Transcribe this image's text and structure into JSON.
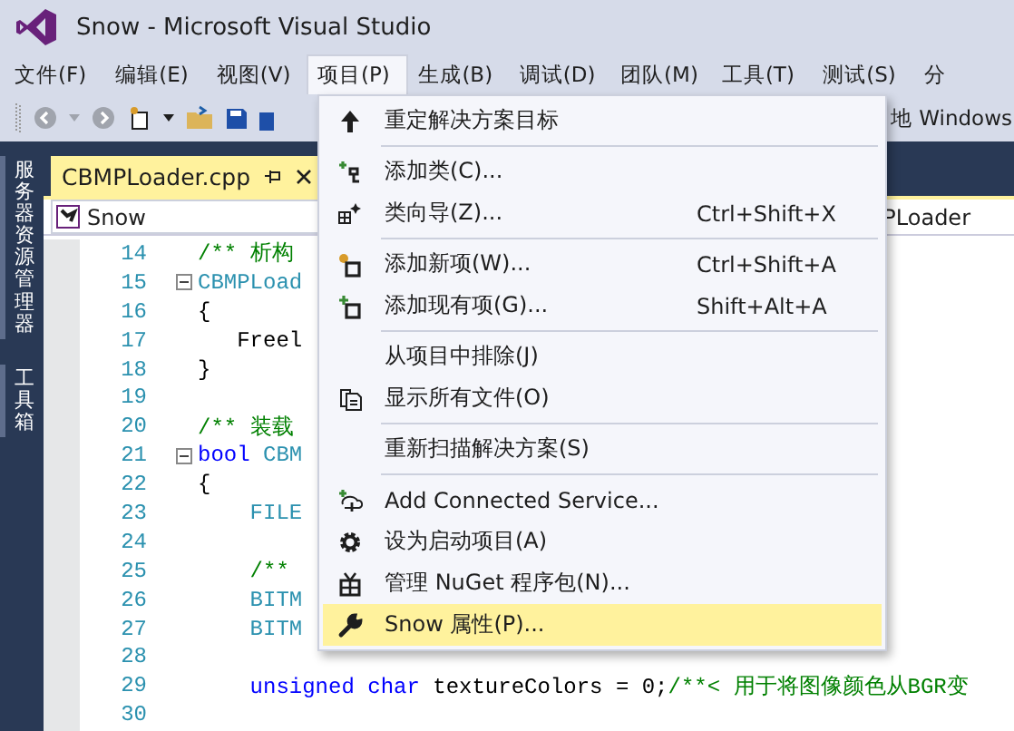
{
  "window": {
    "title": "Snow - Microsoft Visual Studio"
  },
  "menu_bar": [
    {
      "label": "文件(F)",
      "selected": false
    },
    {
      "label": "编辑(E)",
      "selected": false
    },
    {
      "label": "视图(V)",
      "selected": false
    },
    {
      "label": "项目(P)",
      "selected": true
    },
    {
      "label": "生成(B)",
      "selected": false
    },
    {
      "label": "调试(D)",
      "selected": false
    },
    {
      "label": "团队(M)",
      "selected": false
    },
    {
      "label": "工具(T)",
      "selected": false
    },
    {
      "label": "测试(S)",
      "selected": false
    },
    {
      "label": "分",
      "selected": false
    }
  ],
  "toolbar": {
    "target": "地 Windows"
  },
  "side_tabs": [
    "服务器资源管理器",
    "工具箱"
  ],
  "document_tab": {
    "title": "CBMPLoader.cpp"
  },
  "nav_bar": {
    "project": "Snow",
    "member": "PLoader"
  },
  "code_lines": [
    {
      "number": "14",
      "tokens": [
        {
          "kind": "comment",
          "text": "/** 析构"
        }
      ]
    },
    {
      "number": "15",
      "expanded": true,
      "tokens": [
        {
          "kind": "type",
          "text": "CBMPLoad"
        }
      ]
    },
    {
      "number": "16",
      "tokens": [
        {
          "kind": "plain",
          "text": "{"
        }
      ]
    },
    {
      "number": "17",
      "tokens": [
        {
          "kind": "plain",
          "text": "   Freel"
        }
      ]
    },
    {
      "number": "18",
      "tokens": [
        {
          "kind": "plain",
          "text": "}"
        }
      ]
    },
    {
      "number": "19"
    },
    {
      "number": "20",
      "tokens": [
        {
          "kind": "comment",
          "text": "/** 装载"
        }
      ]
    },
    {
      "number": "21",
      "expanded": true,
      "tokens": [
        {
          "kind": "keyword",
          "text": "bool"
        },
        {
          "kind": "type",
          "text": " CBM"
        }
      ]
    },
    {
      "number": "22",
      "tokens": [
        {
          "kind": "plain",
          "text": "{"
        }
      ]
    },
    {
      "number": "23",
      "tokens": [
        {
          "kind": "type",
          "text": "    FILE"
        }
      ]
    },
    {
      "number": "24"
    },
    {
      "number": "25",
      "tokens": [
        {
          "kind": "comment",
          "text": "    /**"
        }
      ]
    },
    {
      "number": "26",
      "tokens": [
        {
          "kind": "type",
          "text": "    BITM"
        }
      ]
    },
    {
      "number": "27",
      "tokens": [
        {
          "kind": "type",
          "text": "    BITM"
        }
      ]
    },
    {
      "number": "28"
    },
    {
      "number": "29",
      "tokens": [
        {
          "kind": "keyword",
          "text": "    unsigned char"
        },
        {
          "kind": "plain",
          "text": " textureColors = 0;"
        },
        {
          "kind": "comment",
          "text": "/**< 用于将图像颜色从BGR变"
        }
      ]
    },
    {
      "number": "30"
    }
  ],
  "project_menu": [
    {
      "kind": "item",
      "label": "重定解决方案目标",
      "selected": false
    },
    {
      "kind": "separator"
    },
    {
      "kind": "item",
      "label": "添加类(C)...",
      "selected": false
    },
    {
      "kind": "item",
      "label": "类向导(Z)...",
      "shortcut": "Ctrl+Shift+X",
      "selected": false
    },
    {
      "kind": "separator"
    },
    {
      "kind": "item",
      "label": "添加新项(W)...",
      "shortcut": "Ctrl+Shift+A",
      "selected": false
    },
    {
      "kind": "item",
      "label": "添加现有项(G)...",
      "shortcut": "Shift+Alt+A",
      "selected": false
    },
    {
      "kind": "separator"
    },
    {
      "kind": "item",
      "label": "从项目中排除(J)",
      "selected": false
    },
    {
      "kind": "item",
      "label": "显示所有文件(O)",
      "selected": false
    },
    {
      "kind": "separator"
    },
    {
      "kind": "item",
      "label": "重新扫描解决方案(S)",
      "selected": false
    },
    {
      "kind": "separator"
    },
    {
      "kind": "item",
      "label": "Add Connected Service...",
      "selected": false
    },
    {
      "kind": "item",
      "label": "设为启动项目(A)",
      "selected": false
    },
    {
      "kind": "item",
      "label": "管理 NuGet 程序包(N)...",
      "selected": false
    },
    {
      "kind": "item",
      "label": "Snow 属性(P)...",
      "selected": true
    }
  ]
}
